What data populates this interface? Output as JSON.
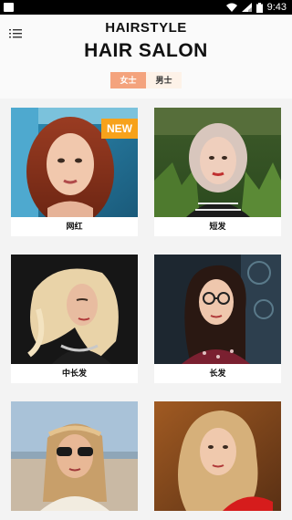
{
  "status_bar": {
    "time": "9:43",
    "icons": [
      "notification-icon",
      "wifi-icon",
      "signal-icon",
      "battery-icon"
    ]
  },
  "header": {
    "title_small": "HAIRSTYLE",
    "title_big": "HAIR SALON",
    "menu_icon": "menu-list-icon"
  },
  "tabs": [
    {
      "label": "女士",
      "active": true
    },
    {
      "label": "男士",
      "active": false
    }
  ],
  "colors": {
    "accent": "#f4a37d",
    "tab_inactive_bg": "#fdf2e8",
    "badge": "#f7a21b"
  },
  "cards": [
    {
      "label": "网红",
      "badge": "NEW"
    },
    {
      "label": "短发"
    },
    {
      "label": "中长发"
    },
    {
      "label": "长发"
    },
    {
      "label": ""
    },
    {
      "label": ""
    }
  ]
}
